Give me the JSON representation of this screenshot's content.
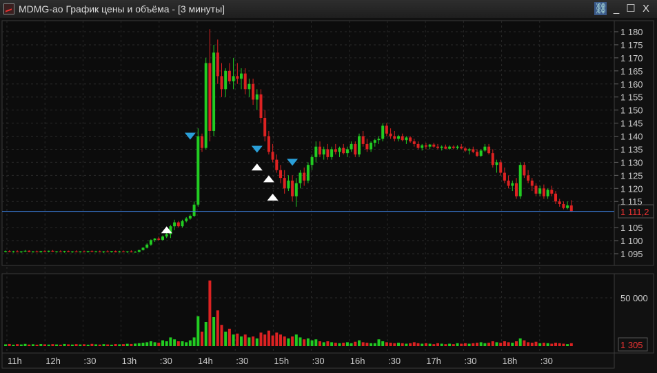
{
  "window": {
    "title": "MDMG-ao График цены и объёма - [3 минуты]",
    "link": "⛓",
    "minimize": "_",
    "maximize": "☐",
    "close": "X"
  },
  "price_axis": {
    "labels": [
      "1 180",
      "1 175",
      "1 170",
      "1 165",
      "1 160",
      "1 155",
      "1 150",
      "1 145",
      "1 140",
      "1 135",
      "1 130",
      "1 125",
      "1 120",
      "1 115",
      "1 105",
      "1 100",
      "1 095"
    ],
    "current": "1 111,2"
  },
  "volume_axis": {
    "labels": [
      "50 000"
    ],
    "current": "1 305"
  },
  "time_axis": {
    "labels": [
      "11h",
      "12h",
      ":30",
      "13h",
      ":30",
      "14h",
      ":30",
      "15h",
      ":30",
      "16h",
      ":30",
      "17h",
      ":30",
      "18h",
      ":30"
    ]
  },
  "colors": {
    "up": "#22cc22",
    "down": "#dd2222",
    "current_line": "#3a7bd5",
    "buy_marker": "#ffffff",
    "sell_marker": "#2a9fd8"
  },
  "chart_data": {
    "type": "candlestick",
    "interval": "3 минуты",
    "ticker": "MDMG-ao",
    "ylim": [
      1092,
      1183
    ],
    "volume_ylim": [
      0,
      68000
    ],
    "markers": [
      {
        "type": "buy",
        "candle": 41,
        "price": 1105.5
      },
      {
        "type": "sell",
        "candle": 47,
        "price": 1140
      },
      {
        "type": "sell",
        "candle": 64,
        "price": 1135
      },
      {
        "type": "buy",
        "candle": 64,
        "price": 1129.5
      },
      {
        "type": "buy",
        "candle": 67,
        "price": 1125
      },
      {
        "type": "buy",
        "candle": 68,
        "price": 1118
      },
      {
        "type": "sell",
        "candle": 73,
        "price": 1130
      }
    ],
    "ohlcv": [
      [
        1095.8,
        1096.2,
        1095.5,
        1096.0,
        1800
      ],
      [
        1096.0,
        1096.3,
        1095.6,
        1095.7,
        2200
      ],
      [
        1095.7,
        1096.1,
        1095.4,
        1095.9,
        1500
      ],
      [
        1095.9,
        1096.3,
        1095.6,
        1095.6,
        2000
      ],
      [
        1095.6,
        1096.0,
        1095.3,
        1095.9,
        1700
      ],
      [
        1095.9,
        1096.4,
        1095.7,
        1096.1,
        2300
      ],
      [
        1096.1,
        1096.3,
        1095.6,
        1095.7,
        1600
      ],
      [
        1095.7,
        1096.0,
        1095.4,
        1095.9,
        1900
      ],
      [
        1095.9,
        1096.2,
        1095.5,
        1095.6,
        1500
      ],
      [
        1095.6,
        1096.1,
        1095.4,
        1096.0,
        2100
      ],
      [
        1096.0,
        1096.3,
        1095.7,
        1095.8,
        1800
      ],
      [
        1095.8,
        1096.2,
        1095.5,
        1096.1,
        1600
      ],
      [
        1096.1,
        1096.4,
        1095.7,
        1095.8,
        2000
      ],
      [
        1095.8,
        1096.0,
        1095.4,
        1095.9,
        1700
      ],
      [
        1095.9,
        1096.3,
        1095.6,
        1095.7,
        1500
      ],
      [
        1095.7,
        1096.1,
        1095.4,
        1096.0,
        2200
      ],
      [
        1096.0,
        1096.2,
        1095.6,
        1095.7,
        1800
      ],
      [
        1095.7,
        1096.0,
        1095.3,
        1095.9,
        1600
      ],
      [
        1095.9,
        1096.3,
        1095.6,
        1095.6,
        2000
      ],
      [
        1095.6,
        1096.0,
        1095.4,
        1095.9,
        1700
      ],
      [
        1095.9,
        1096.2,
        1095.6,
        1095.7,
        1900
      ],
      [
        1095.7,
        1096.1,
        1095.4,
        1096.0,
        1500
      ],
      [
        1096.0,
        1096.3,
        1095.6,
        1095.8,
        2300
      ],
      [
        1095.8,
        1096.1,
        1095.5,
        1095.9,
        1800
      ],
      [
        1095.9,
        1096.2,
        1095.5,
        1095.6,
        1600
      ],
      [
        1095.6,
        1096.0,
        1095.3,
        1095.9,
        2000
      ],
      [
        1095.9,
        1096.3,
        1095.6,
        1095.7,
        1700
      ],
      [
        1095.7,
        1096.0,
        1095.4,
        1096.0,
        1500
      ],
      [
        1096.0,
        1096.2,
        1095.5,
        1095.6,
        2100
      ],
      [
        1095.6,
        1096.1,
        1095.4,
        1095.9,
        1800
      ],
      [
        1095.9,
        1096.2,
        1095.6,
        1095.7,
        2000
      ],
      [
        1095.7,
        1096.0,
        1095.3,
        1095.9,
        2400
      ],
      [
        1095.9,
        1096.3,
        1095.5,
        1095.6,
        2200
      ],
      [
        1095.6,
        1096.0,
        1095.4,
        1095.7,
        2600
      ],
      [
        1095.7,
        1096.5,
        1095.5,
        1096.4,
        3000
      ],
      [
        1096.4,
        1097.5,
        1096.2,
        1097.3,
        3500
      ],
      [
        1097.3,
        1099,
        1097,
        1098.5,
        4000
      ],
      [
        1098.5,
        1100.5,
        1098,
        1100.2,
        5000
      ],
      [
        1100.2,
        1101,
        1099.5,
        1100.8,
        4000
      ],
      [
        1100.8,
        1101.5,
        1100,
        1100.3,
        3500
      ],
      [
        1100.3,
        1102,
        1100,
        1101.6,
        6000
      ],
      [
        1101.6,
        1103,
        1101,
        1102.5,
        5000
      ],
      [
        1102.5,
        1106,
        1101,
        1105.5,
        9000
      ],
      [
        1105.5,
        1108,
        1104,
        1107,
        7000
      ],
      [
        1107,
        1107.5,
        1105,
        1105.5,
        5000
      ],
      [
        1105.5,
        1108,
        1105,
        1107.5,
        5000
      ],
      [
        1107.5,
        1109,
        1107,
        1108.5,
        4000
      ],
      [
        1108.5,
        1110,
        1108,
        1109.5,
        6000
      ],
      [
        1109.5,
        1115,
        1109,
        1113.8,
        9000
      ],
      [
        1113.8,
        1143,
        1113,
        1140,
        31000
      ],
      [
        1140,
        1141,
        1134,
        1135.5,
        15000
      ],
      [
        1135.5,
        1170,
        1135,
        1168,
        25000
      ],
      [
        1168,
        1181,
        1138,
        1142,
        68000
      ],
      [
        1142,
        1175,
        1140,
        1172,
        30000
      ],
      [
        1172,
        1177,
        1160,
        1163,
        37000
      ],
      [
        1163,
        1168,
        1155,
        1158,
        22000
      ],
      [
        1158,
        1166,
        1155,
        1165,
        15000
      ],
      [
        1165,
        1168,
        1160,
        1161,
        18000
      ],
      [
        1161,
        1170,
        1158,
        1163,
        12000
      ],
      [
        1163,
        1168,
        1160,
        1162,
        13000
      ],
      [
        1162,
        1166,
        1158,
        1164,
        10000
      ],
      [
        1164,
        1166,
        1156,
        1158,
        12000
      ],
      [
        1158,
        1162,
        1155,
        1160,
        9000
      ],
      [
        1160,
        1162,
        1152,
        1154,
        10000
      ],
      [
        1154,
        1158,
        1150,
        1156,
        8000
      ],
      [
        1156,
        1158,
        1145,
        1147,
        14000
      ],
      [
        1147,
        1150,
        1138,
        1140,
        12000
      ],
      [
        1140,
        1142,
        1133,
        1134,
        16000
      ],
      [
        1134,
        1137,
        1130,
        1131,
        11000
      ],
      [
        1131,
        1133,
        1126,
        1127,
        14000
      ],
      [
        1127,
        1129,
        1122,
        1124,
        12000
      ],
      [
        1124,
        1127,
        1118,
        1120,
        10000
      ],
      [
        1120,
        1125,
        1119,
        1123,
        8000
      ],
      [
        1123,
        1125,
        1115,
        1117,
        10000
      ],
      [
        1117,
        1124,
        1113,
        1122,
        12000
      ],
      [
        1122,
        1127,
        1120,
        1126,
        9000
      ],
      [
        1126,
        1128,
        1121,
        1123,
        7000
      ],
      [
        1123,
        1130,
        1122,
        1129,
        8000
      ],
      [
        1129,
        1133,
        1127,
        1132,
        6000
      ],
      [
        1132,
        1138,
        1130,
        1136,
        7000
      ],
      [
        1136,
        1138,
        1132,
        1133,
        5000
      ],
      [
        1133,
        1136,
        1131,
        1135,
        4000
      ],
      [
        1135,
        1137,
        1131,
        1132,
        5000
      ],
      [
        1132,
        1136,
        1131,
        1135,
        4000
      ],
      [
        1135,
        1137,
        1133,
        1134,
        3500
      ],
      [
        1134,
        1136,
        1132,
        1135.5,
        3000
      ],
      [
        1135.5,
        1137,
        1133,
        1133.5,
        3500
      ],
      [
        1133.5,
        1136,
        1132,
        1135,
        4000
      ],
      [
        1135,
        1138,
        1134,
        1137,
        3000
      ],
      [
        1137,
        1138,
        1132,
        1133,
        4500
      ],
      [
        1133,
        1141,
        1132,
        1140,
        6000
      ],
      [
        1140,
        1142,
        1136,
        1137,
        4000
      ],
      [
        1137,
        1139,
        1134,
        1135,
        3500
      ],
      [
        1135,
        1138,
        1134,
        1137.5,
        3000
      ],
      [
        1137.5,
        1139,
        1136,
        1138.5,
        3000
      ],
      [
        1138.5,
        1140,
        1137,
        1139,
        7000
      ],
      [
        1139,
        1145,
        1138,
        1144,
        5000
      ],
      [
        1144,
        1145,
        1140,
        1141,
        4000
      ],
      [
        1141,
        1143,
        1139,
        1140,
        3500
      ],
      [
        1140,
        1142,
        1138,
        1139,
        3000
      ],
      [
        1139,
        1140.5,
        1138,
        1140,
        3500
      ],
      [
        1140,
        1141,
        1138,
        1138.5,
        3000
      ],
      [
        1138.5,
        1140,
        1137,
        1139.5,
        2500
      ],
      [
        1139.5,
        1140,
        1137.5,
        1138,
        3000
      ],
      [
        1138,
        1139,
        1136,
        1137,
        4000
      ],
      [
        1137,
        1138,
        1135,
        1135.5,
        3000
      ],
      [
        1135.5,
        1137,
        1134.5,
        1136.5,
        2500
      ],
      [
        1136.5,
        1137.5,
        1135,
        1136,
        3000
      ],
      [
        1136,
        1137,
        1135,
        1136.8,
        2500
      ],
      [
        1136.8,
        1137.5,
        1135.5,
        1136,
        2000
      ],
      [
        1136,
        1137,
        1135,
        1135.5,
        3000
      ],
      [
        1135.5,
        1136.5,
        1134.5,
        1136,
        2500
      ],
      [
        1136,
        1136.8,
        1135,
        1135.2,
        2000
      ],
      [
        1135.2,
        1136.5,
        1134.8,
        1136,
        2500
      ],
      [
        1136,
        1136.5,
        1135,
        1135.5,
        2000
      ],
      [
        1135.5,
        1136.5,
        1135,
        1136,
        3000
      ],
      [
        1136,
        1137,
        1135,
        1135.3,
        2500
      ],
      [
        1135.3,
        1136,
        1134,
        1134.5,
        3000
      ],
      [
        1134.5,
        1135.5,
        1133,
        1135,
        2500
      ],
      [
        1135,
        1136,
        1133.5,
        1134,
        3000
      ],
      [
        1134,
        1135,
        1132,
        1132.5,
        3500
      ],
      [
        1132.5,
        1135,
        1132,
        1134.5,
        4000
      ],
      [
        1134.5,
        1137,
        1134,
        1136,
        3000
      ],
      [
        1136,
        1137,
        1133,
        1133.5,
        3500
      ],
      [
        1133.5,
        1135,
        1128,
        1129,
        5000
      ],
      [
        1129,
        1131,
        1126,
        1130,
        4000
      ],
      [
        1130,
        1131,
        1125,
        1126,
        3500
      ],
      [
        1126,
        1128,
        1122,
        1123,
        5000
      ],
      [
        1123,
        1125,
        1120,
        1121,
        4000
      ],
      [
        1121,
        1123,
        1119,
        1122,
        3500
      ],
      [
        1122,
        1124,
        1116,
        1117,
        5000
      ],
      [
        1117,
        1130,
        1116,
        1129,
        8000
      ],
      [
        1129,
        1130,
        1124,
        1125,
        6000
      ],
      [
        1125,
        1127,
        1122,
        1123,
        4000
      ],
      [
        1123,
        1124,
        1119,
        1121,
        3500
      ],
      [
        1121,
        1122,
        1117,
        1118,
        4500
      ],
      [
        1118,
        1121,
        1117,
        1120,
        3000
      ],
      [
        1120,
        1121.5,
        1116,
        1117,
        3500
      ],
      [
        1117,
        1120,
        1116,
        1119.5,
        3000
      ],
      [
        1119.5,
        1121,
        1117,
        1118,
        2500
      ],
      [
        1118,
        1119,
        1114,
        1115,
        3500
      ],
      [
        1115,
        1116,
        1113,
        1114,
        3000
      ],
      [
        1114,
        1115,
        1112,
        1112.5,
        2500
      ],
      [
        1112.5,
        1115,
        1112,
        1113.5,
        2000
      ],
      [
        1113.5,
        1115.5,
        1111,
        1111.2,
        3000
      ]
    ]
  }
}
